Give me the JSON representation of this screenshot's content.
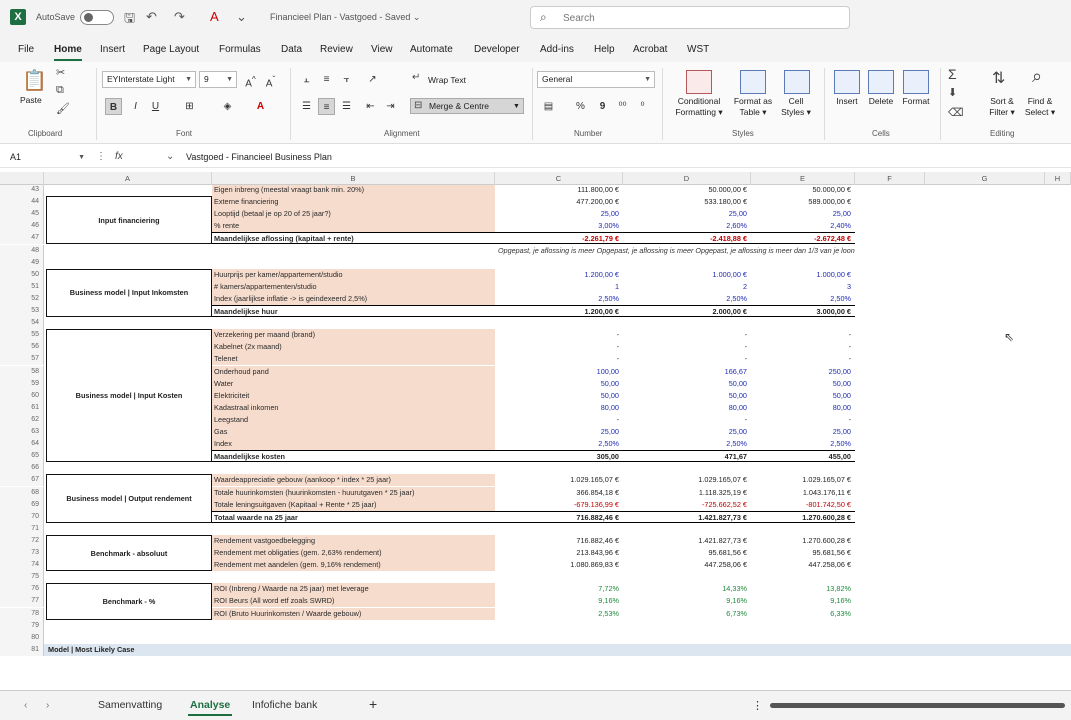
{
  "titlebar": {
    "autosave": "AutoSave",
    "doc_title": "Financieel Plan - Vastgoed - Saved ⌄",
    "search_placeholder": "Search"
  },
  "menu": [
    "File",
    "Home",
    "Insert",
    "Page Layout",
    "Formulas",
    "Data",
    "Review",
    "View",
    "Automate",
    "Developer",
    "Add-ins",
    "Help",
    "Acrobat",
    "WST"
  ],
  "ribbon": {
    "paste": "Paste",
    "font_name": "EYInterstate Light",
    "font_size": "9",
    "wrap_text": "Wrap Text",
    "merge_centre": "Merge & Centre",
    "number_format": "General",
    "conditional_formatting": "Conditional\nFormatting ▾",
    "format_as_table": "Format as\nTable ▾",
    "cell_styles": "Cell\nStyles ▾",
    "insert": "Insert",
    "delete": "Delete",
    "format": "Format",
    "sort_filter": "Sort &\nFilter ▾",
    "find_select": "Find &\nSelect ▾",
    "groups": [
      "Clipboard",
      "Font",
      "Alignment",
      "Number",
      "Styles",
      "Cells",
      "Editing"
    ]
  },
  "formula_bar": {
    "name_box": "A1",
    "formula": "Vastgoed - Financieel Business Plan"
  },
  "columns": [
    "A",
    "B",
    "C",
    "D",
    "E",
    "F",
    "G",
    "H"
  ],
  "sections": [
    {
      "label": "Input financiering",
      "first": 44,
      "last": 47
    },
    {
      "label": "Business model | Input Inkomsten",
      "first": 50,
      "last": 53
    },
    {
      "label": "Business model | Input Kosten",
      "first": 55,
      "last": 65
    },
    {
      "label": "Business model | Output rendement",
      "first": 67,
      "last": 70
    },
    {
      "label": "Benchmark - absoluut",
      "first": 72,
      "last": 74
    },
    {
      "label": "Benchmark - %",
      "first": 76,
      "last": 78
    }
  ],
  "rows": [
    {
      "n": "43",
      "label": "Eigen inbreng (meestal vraagt bank min. 20%)",
      "v": [
        "111.800,00 €",
        "50.000,00 €",
        "50.000,00 €"
      ],
      "color": ""
    },
    {
      "n": "44",
      "label": "Externe financiering",
      "v": [
        "477.200,00 €",
        "533.180,00 €",
        "589.000,00 €"
      ],
      "color": ""
    },
    {
      "n": "45",
      "label": "Looptijd (betaal je op 20 of 25 jaar?)",
      "v": [
        "25,00",
        "25,00",
        "25,00"
      ],
      "color": "blue"
    },
    {
      "n": "46",
      "label": "% rente",
      "v": [
        "3,00%",
        "2,60%",
        "2,40%"
      ],
      "color": "blue"
    },
    {
      "n": "47",
      "label": "Maandelijkse aflossing (kapitaal + rente)",
      "v": [
        "-2.261,79 €",
        "-2.418,88 €",
        "-2.672,48 €"
      ],
      "color": "red",
      "total": true
    },
    {
      "n": "48",
      "note": "Opgepast, je aflossing is meer Opgepast, je aflossing is meer Opgepast, je aflossing is meer dan 1/3 van je loon"
    },
    {
      "n": "49"
    },
    {
      "n": "50",
      "label": "Huurprijs per kamer/appartement/studio",
      "v": [
        "1.200,00 €",
        "1.000,00 €",
        "1.000,00 €"
      ],
      "color": "blue"
    },
    {
      "n": "51",
      "label": "# kamers/appartementen/studio",
      "v": [
        "1",
        "2",
        "3"
      ],
      "color": "blue"
    },
    {
      "n": "52",
      "label": "Index (jaarlijkse inflatie -> is geindexeerd 2,5%)",
      "v": [
        "2,50%",
        "2,50%",
        "2,50%"
      ],
      "color": "blue"
    },
    {
      "n": "53",
      "label": "Maandelijkse huur",
      "v": [
        "1.200,00 €",
        "2.000,00 €",
        "3.000,00 €"
      ],
      "color": "",
      "total": true
    },
    {
      "n": "54"
    },
    {
      "n": "55",
      "label": "Verzekering per maand (brand)",
      "v": [
        "-",
        "-",
        "-"
      ],
      "color": ""
    },
    {
      "n": "56",
      "label": "Kabelnet (2x maand)",
      "v": [
        "-",
        "-",
        "-"
      ],
      "color": ""
    },
    {
      "n": "57",
      "label": "Telenet",
      "v": [
        "-",
        "-",
        "-"
      ],
      "color": ""
    },
    {
      "n": "58",
      "label": "Onderhoud pand",
      "v": [
        "100,00",
        "166,67",
        "250,00"
      ],
      "color": "blue"
    },
    {
      "n": "59",
      "label": "Water",
      "v": [
        "50,00",
        "50,00",
        "50,00"
      ],
      "color": "blue"
    },
    {
      "n": "60",
      "label": "Elektriciteit",
      "v": [
        "50,00",
        "50,00",
        "50,00"
      ],
      "color": "blue"
    },
    {
      "n": "61",
      "label": "Kadastraal inkomen",
      "v": [
        "80,00",
        "80,00",
        "80,00"
      ],
      "color": "blue"
    },
    {
      "n": "62",
      "label": "Leegstand",
      "v": [
        "-",
        "-",
        "-"
      ],
      "color": ""
    },
    {
      "n": "63",
      "label": "Gas",
      "v": [
        "25,00",
        "25,00",
        "25,00"
      ],
      "color": "blue"
    },
    {
      "n": "64",
      "label": "Index",
      "v": [
        "2,50%",
        "2,50%",
        "2,50%"
      ],
      "color": "blue"
    },
    {
      "n": "65",
      "label": "Maandelijkse kosten",
      "v": [
        "305,00",
        "471,67",
        "455,00"
      ],
      "color": "",
      "total": true
    },
    {
      "n": "66"
    },
    {
      "n": "67",
      "label": "Waardeappreciatie gebouw (aankoop * index * 25 jaar)",
      "v": [
        "1.029.165,07 €",
        "1.029.165,07 €",
        "1.029.165,07 €"
      ],
      "color": ""
    },
    {
      "n": "68",
      "label": "Totale huurinkomsten (huurinkomsten - huurutgaven * 25 jaar)",
      "v": [
        "366.854,18 €",
        "1.118.325,19 €",
        "1.043.176,11 €"
      ],
      "color": ""
    },
    {
      "n": "69",
      "label": "Totale leningsuitgaven (Kapitaal + Rente * 25 jaar)",
      "v": [
        "-679.136,99 €",
        "-725.662,52 €",
        "-801.742,50 €"
      ],
      "color": "red"
    },
    {
      "n": "70",
      "label": "Totaal waarde na 25 jaar",
      "v": [
        "716.882,46 €",
        "1.421.827,73 €",
        "1.270.600,28 €"
      ],
      "color": "",
      "total": true
    },
    {
      "n": "71"
    },
    {
      "n": "72",
      "label": "Rendement vastgoedbelegging",
      "v": [
        "716.882,46 €",
        "1.421.827,73 €",
        "1.270.600,28 €"
      ],
      "color": ""
    },
    {
      "n": "73",
      "label": "Rendement met obligaties (gem. 2,63% rendement)",
      "v": [
        "213.843,96 €",
        "95.681,56 €",
        "95.681,56 €"
      ],
      "color": ""
    },
    {
      "n": "74",
      "label": "Rendement met aandelen (gem. 9,16% rendement)",
      "v": [
        "1.080.869,83 €",
        "447.258,06 €",
        "447.258,06 €"
      ],
      "color": ""
    },
    {
      "n": "75"
    },
    {
      "n": "76",
      "label": "ROI (Inbreng / Waarde na 25 jaar) met leverage",
      "v": [
        "7,72%",
        "14,33%",
        "13,82%"
      ],
      "color": "green"
    },
    {
      "n": "77",
      "label": "ROI Beurs (All word etf zoals SWRD)",
      "v": [
        "9,16%",
        "9,16%",
        "9,16%"
      ],
      "color": "green"
    },
    {
      "n": "78",
      "label": "ROI (Bruto Huurinkomsten / Waarde gebouw)",
      "v": [
        "2,53%",
        "6,73%",
        "6,33%"
      ],
      "color": "green"
    },
    {
      "n": "79"
    },
    {
      "n": "80"
    },
    {
      "n": "81",
      "banner": "Model | Most Likely Case"
    }
  ],
  "sheet_tabs": [
    "Samenvatting",
    "Analyse",
    "Infofiche bank"
  ],
  "active_sheet": "Analyse"
}
